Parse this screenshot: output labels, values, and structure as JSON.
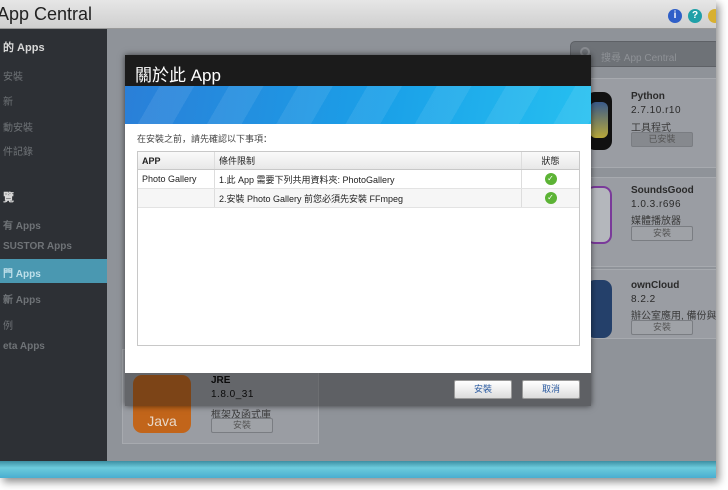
{
  "window": {
    "title": "App Central"
  },
  "titlebar_icons": [
    {
      "name": "info-icon",
      "glyph": "i",
      "color": "#2f5fc8"
    },
    {
      "name": "help-icon",
      "glyph": "?",
      "color": "#1fa0a8"
    },
    {
      "name": "user-icon",
      "glyph": "",
      "color": "#d8b030"
    }
  ],
  "sidebar": {
    "items": [
      {
        "label": "的 Apps",
        "type": "header"
      },
      {
        "label": "安裝"
      },
      {
        "label": "新"
      },
      {
        "label": "動安裝"
      },
      {
        "label": "件記錄"
      },
      {
        "label": "覽",
        "type": "header"
      },
      {
        "label": "有 Apps"
      },
      {
        "label": "SUSTOR Apps"
      },
      {
        "label": "門 Apps",
        "active": true
      },
      {
        "label": "新 Apps"
      },
      {
        "label": "例"
      },
      {
        "label": "eta Apps"
      }
    ]
  },
  "search": {
    "placeholder": "搜尋 App Central"
  },
  "apps": [
    {
      "name": "Python",
      "version": "2.7.10.r10",
      "category": "工具程式",
      "button": "已安裝"
    },
    {
      "name": "SoundsGood",
      "version": "1.0.3.r696",
      "category": "媒體播放器",
      "button": "安裝"
    },
    {
      "name": "ownCloud",
      "version": "8.2.2",
      "category": "辦公室應用, 備份與",
      "button": "安裝"
    },
    {
      "name": "JRE",
      "version": "1.8.0_31",
      "category": "框架及函式庫",
      "button": "安裝",
      "icon_text": "Java"
    }
  ],
  "dialog": {
    "title": "關於此 App",
    "note": "在安裝之前，請先確認以下事項：",
    "columns": [
      "APP",
      "條件限制",
      "狀態"
    ],
    "rows": [
      {
        "app": "Photo Gallery",
        "condition": "1.此 App 需要下列共用資料夾: PhotoGallery",
        "status": "ok"
      },
      {
        "app": "",
        "condition": "2.安裝 Photo Gallery 前您必須先安裝 FFmpeg",
        "status": "ok"
      }
    ],
    "install_label": "安裝",
    "cancel_label": "取消"
  }
}
